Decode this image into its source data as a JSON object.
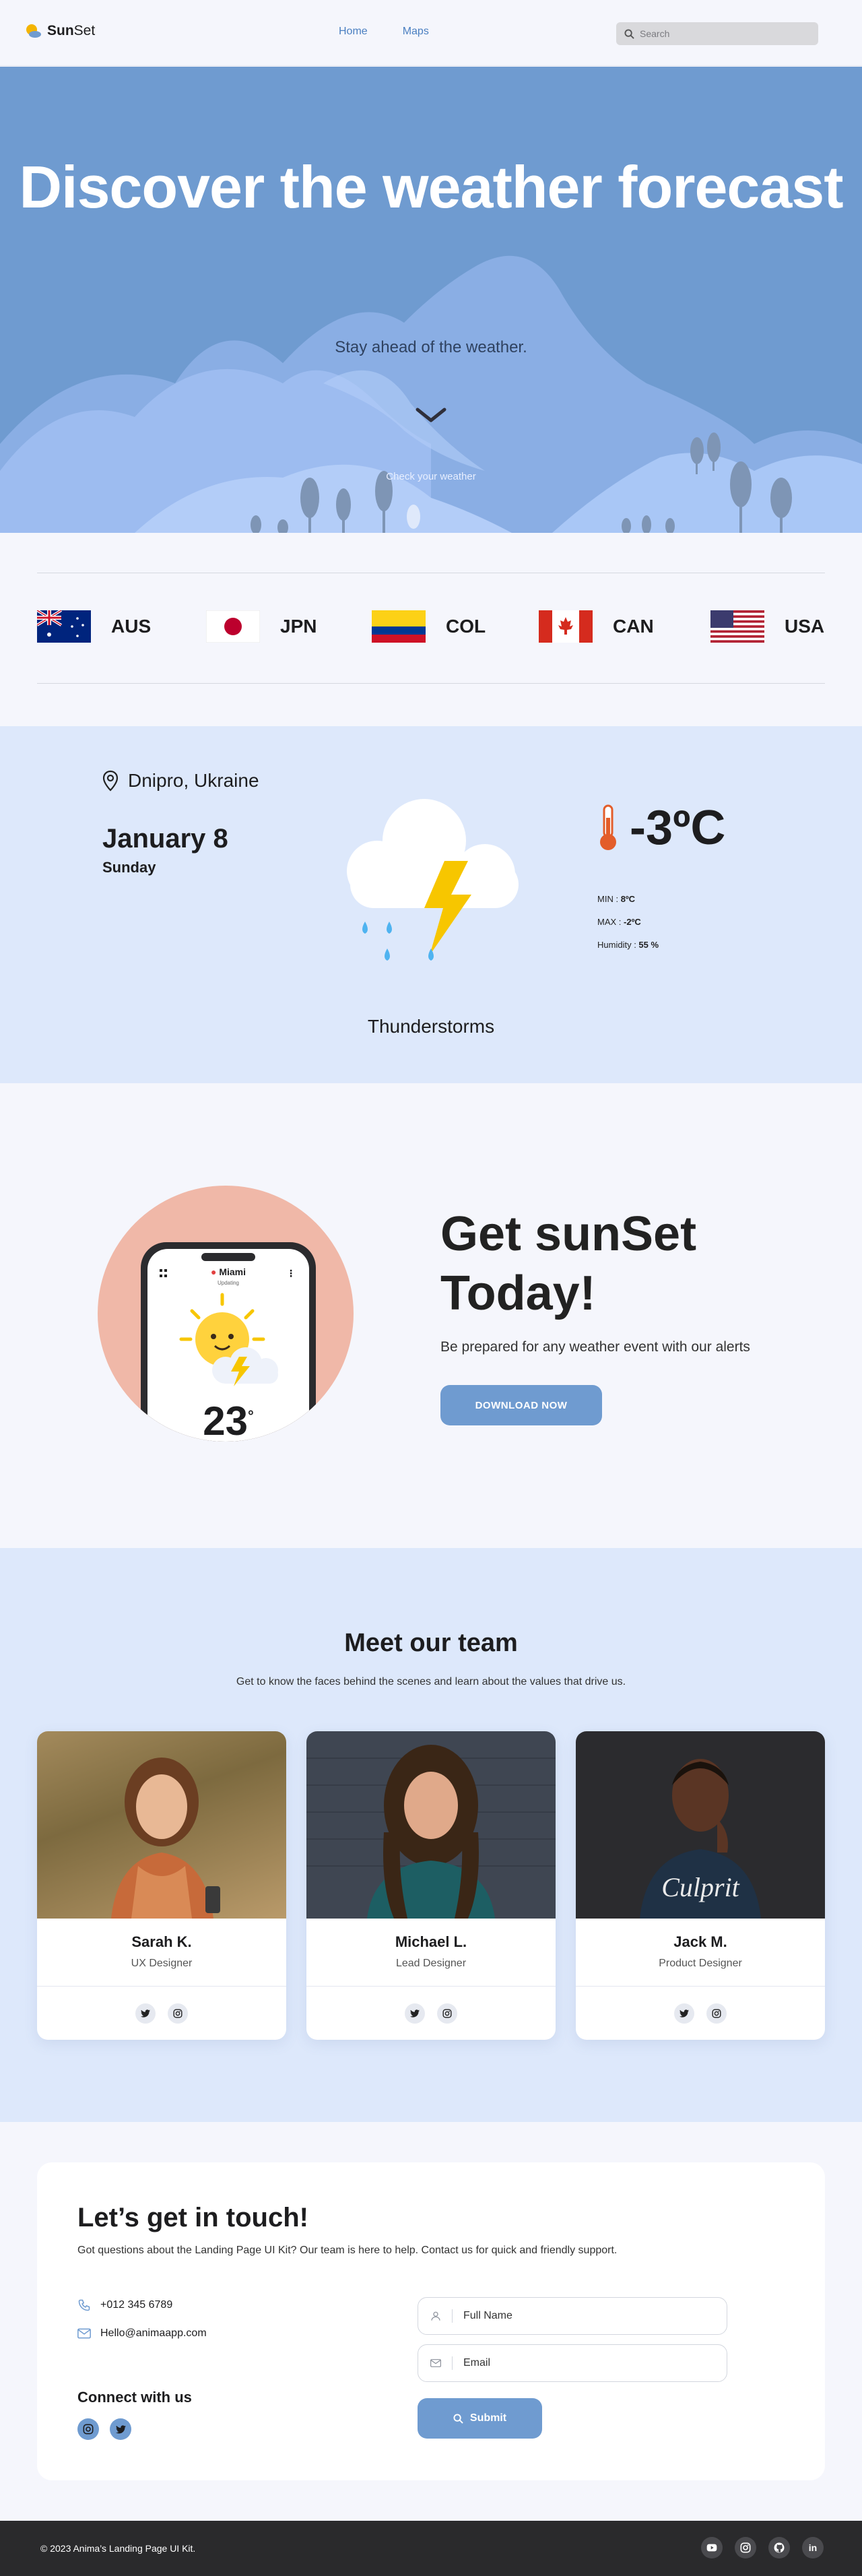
{
  "nav": {
    "logo_bold": "Sun",
    "logo_rest": "Set",
    "links": [
      "Home",
      "Maps"
    ],
    "search_placeholder": "Search"
  },
  "hero": {
    "title": "Discover the weather forecast",
    "subtitle": "Stay ahead of the weather.",
    "check_label": "Check your weather"
  },
  "countries": [
    {
      "code": "AUS",
      "flag": "australia-flag-icon"
    },
    {
      "code": "JPN",
      "flag": "japan-flag-icon"
    },
    {
      "code": "COL",
      "flag": "colombia-flag-icon"
    },
    {
      "code": "CAN",
      "flag": "canada-flag-icon"
    },
    {
      "code": "USA",
      "flag": "usa-flag-icon"
    }
  ],
  "weather": {
    "location": "Dnipro, Ukraine",
    "date": "January 8",
    "day": "Sunday",
    "condition": "Thunderstorms",
    "temperature": "-3ºC",
    "min_label": "MIN",
    "min_value": "8ºC",
    "max_label": "MAX",
    "max_value": "-2ºC",
    "humidity_label": "Humidity",
    "humidity_value": "55 %"
  },
  "promo": {
    "title": "Get sunSet Today!",
    "subtitle": "Be prepared for any weather event with our alerts",
    "button": "DOWNLOAD NOW",
    "phone_city": "Miami",
    "phone_status": "Updating",
    "phone_temp": "23"
  },
  "team": {
    "title": "Meet our team",
    "subtitle": "Get to know the faces behind the scenes and learn about the values that drive us.",
    "members": [
      {
        "name": "Sarah K.",
        "role": "UX Designer"
      },
      {
        "name": "Michael L.",
        "role": "Lead Designer"
      },
      {
        "name": "Jack M.",
        "role": "Product Designer"
      }
    ]
  },
  "contact": {
    "title": "Let’s get in touch!",
    "subtitle": "Got questions about the Landing Page UI Kit? Our team is here to help. Contact us for quick and friendly support.",
    "phone": "+012 345 6789",
    "email": "Hello@animaapp.com",
    "connect_label": "Connect with us",
    "name_placeholder": "Full Name",
    "email_placeholder": "Email",
    "submit": "Submit"
  },
  "footer": {
    "copyright": "© 2023 Anima’s Landing Page UI Kit."
  },
  "colors": {
    "accent": "#6f9bd0",
    "hero_bg": "#6f9bd0",
    "light_bg": "#dde8fb",
    "footer_bg": "#2a2a2c"
  }
}
